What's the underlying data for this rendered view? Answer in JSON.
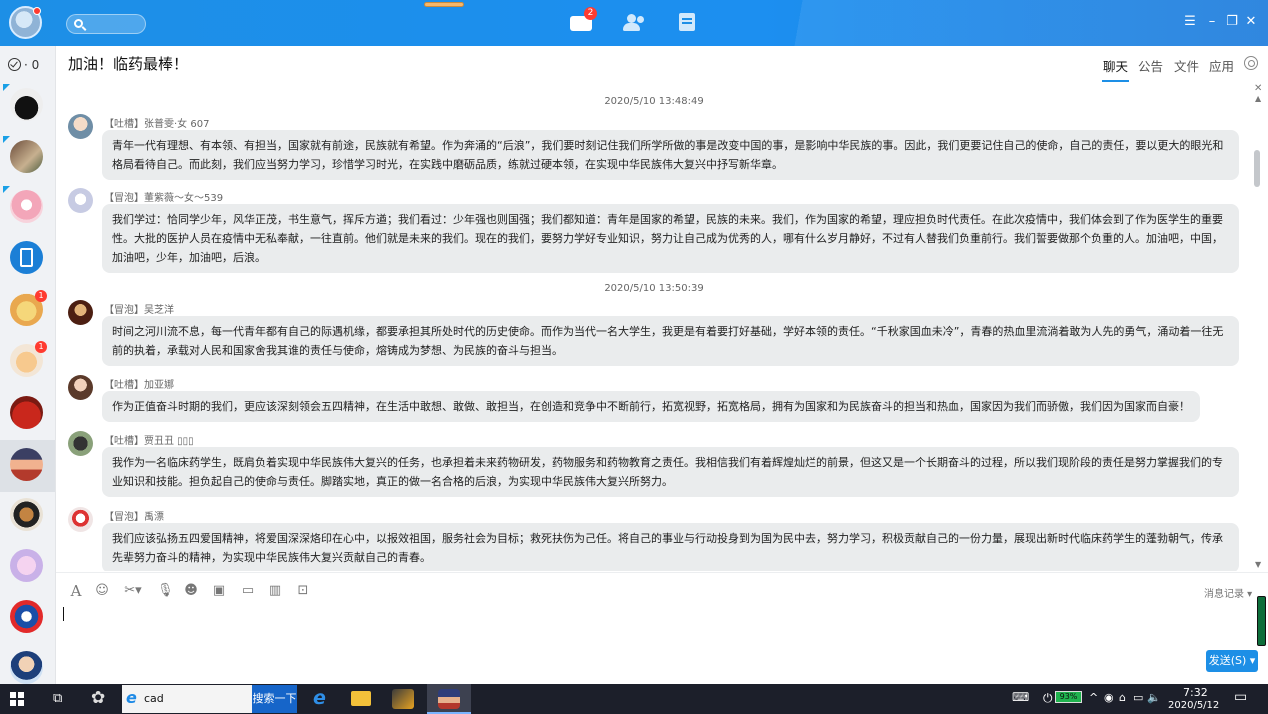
{
  "topbar": {
    "message_badge": "2",
    "win_menu": "☰",
    "win_min": "–",
    "win_max": "❐",
    "win_close": "✕"
  },
  "sidebar": {
    "todo_count": "· 0",
    "conversations": [
      {
        "badge": ""
      },
      {
        "badge": ""
      },
      {
        "badge": ""
      },
      {
        "badge": ""
      },
      {
        "badge": "1"
      },
      {
        "badge": "1"
      },
      {
        "badge": ""
      },
      {
        "badge": ""
      },
      {
        "badge": ""
      },
      {
        "badge": ""
      },
      {
        "badge": ""
      },
      {
        "badge": ""
      }
    ]
  },
  "chat": {
    "title": "加油！临药最棒！",
    "tabs": [
      "聊天",
      "公告",
      "文件",
      "应用"
    ]
  },
  "messages": {
    "timestamps": [
      "2020/5/10 13:48:49",
      "2020/5/10 13:50:39"
    ],
    "items": [
      {
        "sender": "【吐槽】张普雯·女 607",
        "text": "青年一代有理想、有本领、有担当，国家就有前途，民族就有希望。作为奔涌的“后浪”，我们要时刻记住我们所学所做的事是改变中国的事，是影响中华民族的事。因此，我们更要记住自己的使命，自己的责任，要以更大的眼光和格局看待自己。而此刻，我们应当努力学习，珍惜学习时光，在实践中磨砺品质，练就过硬本领，在实现中华民族伟大复兴中抒写新华章。"
      },
      {
        "sender": "【冒泡】董紫薇～女～539",
        "text": "我们学过：恰同学少年，风华正茂，书生意气，挥斥方遒；我们看过：少年强也则国强；我们都知道：青年是国家的希望，民族的未来。我们，作为国家的希望，理应担负时代责任。在此次疫情中，我们体会到了作为医学生的重要性。大批的医护人员在疫情中无私奉献，一往直前。他们就是未来的我们。现在的我们，要努力学好专业知识，努力让自己成为优秀的人，哪有什么岁月静好，不过有人替我们负重前行。我们誓要做那个负重的人。加油吧，中国，加油吧，少年，加油吧，后浪。"
      },
      {
        "sender": "【冒泡】吴芝洋",
        "text": "时间之河川流不息，每一代青年都有自己的际遇机缘，都要承担其所处时代的历史使命。而作为当代一名大学生，我更是有着要打好基础，学好本领的责任。“千秋家国血未冷”，青春的热血里流淌着敢为人先的勇气，涌动着一往无前的执着，承载对人民和国家舍我其谁的责任与使命，熔铸成为梦想、为民族的奋斗与担当。"
      },
      {
        "sender": "【吐槽】加亚娜",
        "text": "作为正值奋斗时期的我们，更应该深刻领会五四精神，在生活中敢想、敢做、敢担当，在创造和竞争中不断前行，拓宽视野，拓宽格局，拥有为国家和为民族奋斗的担当和热血，国家因为我们而骄傲，我们因为国家而自豪！"
      },
      {
        "sender": "【吐槽】贾丑丑 ▯▯▯",
        "text": "我作为一名临床药学生，既肩负着实现中华民族伟大复兴的任务，也承担着未来药物研发，药物服务和药物教育之责任。我相信我们有着辉煌灿烂的前景，但这又是一个长期奋斗的过程，所以我们现阶段的责任是努力掌握我们的专业知识和技能。担负起自己的使命与责任。脚踏实地，真正的做一名合格的后浪，为实现中华民族伟大复兴所努力。"
      },
      {
        "sender": "【冒泡】禹漂",
        "text": "我们应该弘扬五四爱国精神，将爱国深深烙印在心中，以报效祖国，服务社会为目标；救死扶伤为己任。将自己的事业与行动投身到为国为民中去，努力学习，积极贡献自己的一份力量，展现出新时代临床药学生的蓬勃朝气，传承先辈努力奋斗的精神，为实现中华民族伟大复兴贡献自己的青春。"
      }
    ]
  },
  "input": {
    "history_label": "消息记录 ▾",
    "send_label": "发送(S) ▾"
  },
  "taskbar": {
    "search_text": "cad",
    "search_button": "搜索一下",
    "battery": "93%",
    "time": "7:32",
    "date": "2020/5/12"
  }
}
